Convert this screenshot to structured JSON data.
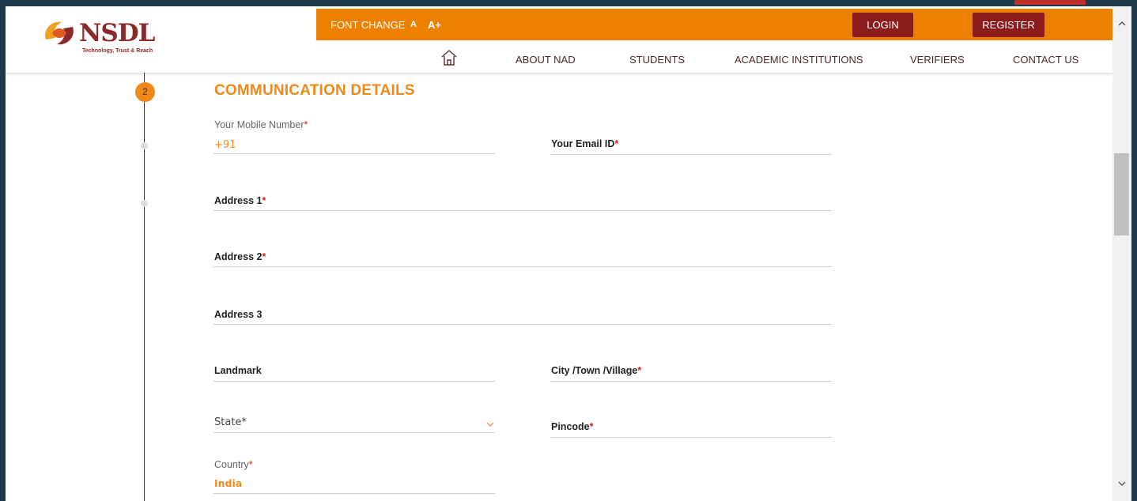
{
  "header": {
    "logo_text": "NSDL",
    "logo_tagline": "Technology, Trust & Reach",
    "font_change_label": "FONT CHANGE",
    "font_small": "A",
    "font_large": "A+",
    "login_label": "LOGIN",
    "register_label": "REGISTER"
  },
  "nav": {
    "items": [
      "ABOUT NAD",
      "STUDENTS",
      "ACADEMIC INSTITUTIONS",
      "VERIFIERS",
      "CONTACT US"
    ]
  },
  "step": {
    "number": "2",
    "title": "COMMUNICATION DETAILS"
  },
  "form": {
    "mobile": {
      "label": "Your Mobile Number",
      "value": "+91"
    },
    "email": {
      "label": "Your Email ID"
    },
    "address1": {
      "label": "Address 1"
    },
    "address2": {
      "label": "Address 2"
    },
    "address3": {
      "label": "Address 3"
    },
    "landmark": {
      "label": "Landmark"
    },
    "city": {
      "label": "City /Town /Village"
    },
    "state": {
      "label": "State*"
    },
    "pincode": {
      "label": "Pincode"
    },
    "country": {
      "label": "Country",
      "value": "India"
    },
    "required_mark": "*"
  },
  "colors": {
    "accent_orange": "#ee8000",
    "brand_maroon": "#8c1c1c",
    "required_red": "#d02020"
  }
}
